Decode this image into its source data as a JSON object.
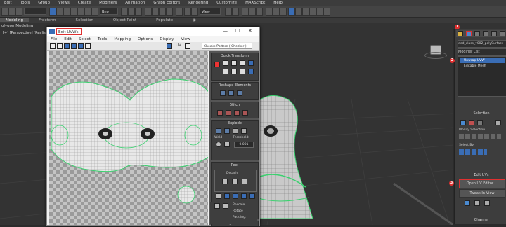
{
  "menubar": {
    "items": [
      "Edit",
      "Tools",
      "Group",
      "Views",
      "Create",
      "Modifiers",
      "Animation",
      "Graph Editors",
      "Rendering",
      "Customize",
      "MAXScript",
      "Help"
    ]
  },
  "toolbar": {
    "undo_field": "",
    "filter_field": "Bno",
    "view_field": "View"
  },
  "ribbon": {
    "tabs": [
      "Modeling",
      "Freeform",
      "Selection",
      "Object Paint",
      "Populate"
    ],
    "extra": "◉·"
  },
  "polybar": {
    "label": "olygon Modeling"
  },
  "viewport": {
    "label": "[+] [Perspective] [Realistic"
  },
  "uv_editor": {
    "title": "Edit UVWs",
    "window_controls": {
      "minimize": "—",
      "maximize": "☐",
      "close": "✕"
    },
    "menu": [
      "File",
      "Edit",
      "Select",
      "Tools",
      "Mapping",
      "Options",
      "Display",
      "View"
    ],
    "uv_label": "UV",
    "checker_value": "CheckerPattern  ( Checker )",
    "panel": {
      "quick_transform": "Quick Transform",
      "reshape": "Reshape Elements",
      "stitch": "Stitch",
      "explode": "Explode",
      "weld": "Weld",
      "threshold_label": "Threshold:",
      "threshold_value": "0.001",
      "peel": "Peel",
      "detach": "Detach",
      "arrange": "Arrange Elements",
      "rescale": "Rescale",
      "rotate": "Rotate",
      "padding": "Padding:"
    }
  },
  "command_panel": {
    "object_name": "ded_class_v002_polySurface",
    "modifier_list": "Modifier List",
    "stack": [
      "Unwrap UVW",
      "Editable Mesh"
    ],
    "selection": "Selection",
    "modify_selection": "Modify Selection",
    "select_by": "Select By:",
    "edit_uvs": "Edit UVs",
    "open_uv_editor": "Open UV Editor ...",
    "tweak_in_view": "Tweak In View",
    "channel": "Channel",
    "badges": [
      "1",
      "2",
      "3"
    ]
  },
  "colors": {
    "accent_red": "#e03030",
    "uv_green": "#3bd16f",
    "panel_bg": "#3d3d3d",
    "highlight_blue": "#3a6db5"
  }
}
